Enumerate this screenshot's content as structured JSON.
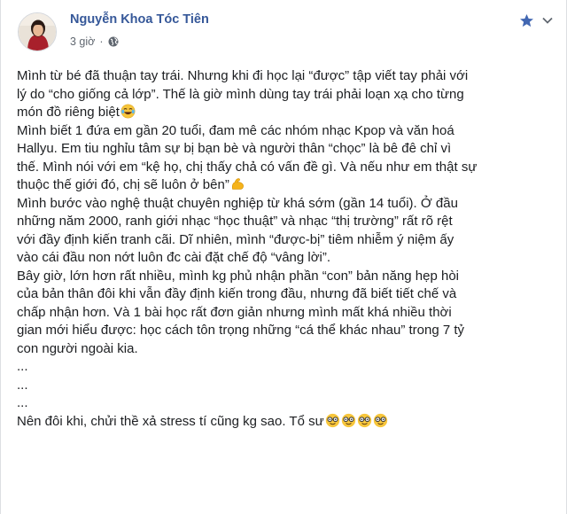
{
  "post": {
    "author": "Nguyễn Khoa Tóc Tiên",
    "timestamp": "3 giờ",
    "separator": "·",
    "privacy_icon": "globe-icon",
    "star_icon": "star-icon",
    "menu_icon": "chevron-down-icon",
    "colors": {
      "author": "#365899",
      "meta": "#606770",
      "star": "#4267b2"
    }
  },
  "content": {
    "p1": "Mình từ bé đã thuận tay trái. Nhưng khi đi học lại “được” tập viết tay phải với\nlý do “cho giống cả lớp”. Thế là giờ mình dùng tay trái phải loạn xạ cho từng\nmón đồ riêng biệt",
    "p2": "Mình biết 1 đứa em gần 20 tuổi, đam mê các nhóm nhạc Kpop và văn hoá\nHallyu. Em tiu nghỉu tâm sự bị bạn bè và người thân “chọc” là bê đê chỉ vì\nthế. Mình nói với em “kệ họ, chị thấy chả có vấn đề gì. Và nếu như em thật sự\nthuộc thế giới đó, chị sẽ luôn ở bên”",
    "p3": "Mình bước vào nghệ thuật chuyên nghiệp từ khá sớm (gần 14 tuổi). Ở đầu\nnhững năm 2000, ranh giới nhạc “học thuật” và nhạc “thị trường” rất rõ rệt\nvới đầy định kiến tranh cãi. Dĩ nhiên, mình “được-bị” tiêm nhiễm ý niệm ấy\nvào cái đầu non nớt luôn đc cài đặt chế độ “vâng lời”.",
    "p4": "Bây giờ, lớn hơn rất nhiều, mình kg phủ nhận phần “con” bản năng hẹp hòi\ncủa bản thân đôi khi vẫn đầy định kiến trong đầu, nhưng đã biết tiết chế và\nchấp nhận hơn. Và 1 bài học rất đơn giản nhưng mình mất khá nhiều thời\ngian mới hiểu được: học cách tôn trọng những “cá thể khác nhau” trong 7 tỷ\ncon người ngoài kia.",
    "ellipsis1": "...",
    "ellipsis2": "...",
    "ellipsis3": "...",
    "p5": "Nên đôi khi, chửi thề xả stress tí cũng kg sao. Tổ sư",
    "emoji_laugh": "tears-of-joy-emoji",
    "emoji_muscle": "flexed-biceps-emoji",
    "emoji_nerd": "nerd-face-emoji"
  }
}
